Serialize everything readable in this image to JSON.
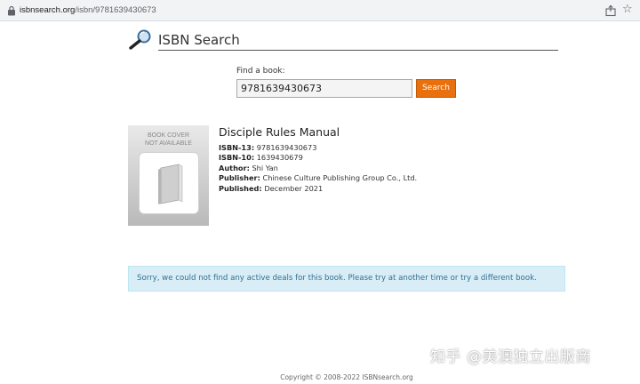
{
  "browser": {
    "url_host": "isbnsearch.org",
    "url_path": "/isbn/9781639430673"
  },
  "header": {
    "title": "ISBN Search"
  },
  "search": {
    "label": "Find a book:",
    "value": "9781639430673",
    "button_label": "Search"
  },
  "cover": {
    "placeholder_text": "BOOK COVER\nNOT AVAILABLE"
  },
  "book": {
    "title": "Disciple Rules Manual",
    "fields": [
      {
        "label": "ISBN-13:",
        "value": "9781639430673"
      },
      {
        "label": "ISBN-10:",
        "value": "1639430679"
      },
      {
        "label": "Author:",
        "value": "Shi Yan"
      },
      {
        "label": "Publisher:",
        "value": "Chinese Culture Publishing Group Co., Ltd."
      },
      {
        "label": "Published:",
        "value": "December 2021"
      }
    ]
  },
  "alert": {
    "message": "Sorry, we could not find any active deals for this book. Please try at another time or try a different book."
  },
  "watermark": {
    "text": "知乎 @美澳独立出版商"
  },
  "footer": {
    "copyright": "Copyright © 2008-2022 ISBNsearch.org"
  },
  "colors": {
    "accent": "#e8700f",
    "alert_bg": "#d9edf7",
    "alert_text": "#31708f"
  }
}
